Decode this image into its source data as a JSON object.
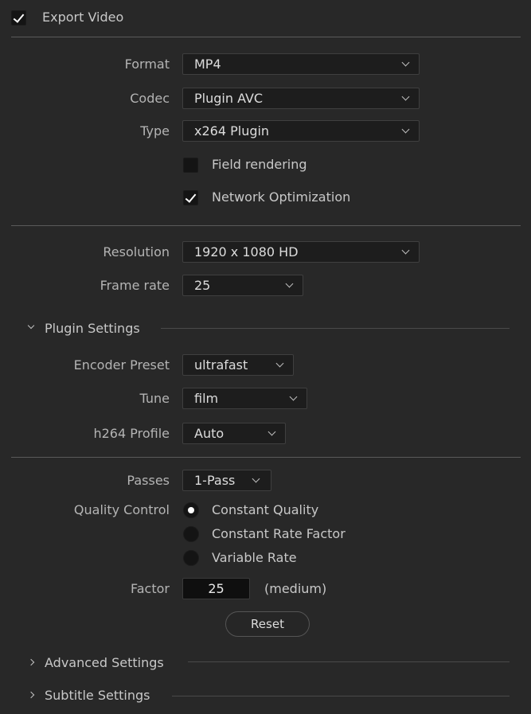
{
  "export_video": {
    "label": "Export Video",
    "checked": true
  },
  "video": {
    "format": {
      "label": "Format",
      "value": "MP4"
    },
    "codec": {
      "label": "Codec",
      "value": "Plugin AVC"
    },
    "type": {
      "label": "Type",
      "value": "x264 Plugin"
    },
    "field_rendering": {
      "label": "Field rendering",
      "checked": false
    },
    "network_optimization": {
      "label": "Network Optimization",
      "checked": true
    }
  },
  "resolution": {
    "label": "Resolution",
    "value": "1920 x 1080 HD"
  },
  "frame_rate": {
    "label": "Frame rate",
    "value": "25"
  },
  "plugin_settings": {
    "title": "Plugin Settings",
    "encoder_preset": {
      "label": "Encoder Preset",
      "value": "ultrafast"
    },
    "tune": {
      "label": "Tune",
      "value": "film"
    },
    "h264_profile": {
      "label": "h264 Profile",
      "value": "Auto"
    }
  },
  "passes": {
    "label": "Passes",
    "value": "1-Pass"
  },
  "quality_control": {
    "label": "Quality Control",
    "options": [
      "Constant Quality",
      "Constant Rate Factor",
      "Variable Rate"
    ],
    "selected": "Constant Quality"
  },
  "factor": {
    "label": "Factor",
    "value": "25",
    "hint": "(medium)"
  },
  "reset_label": "Reset",
  "advanced_settings": {
    "title": "Advanced Settings"
  },
  "subtitle_settings": {
    "title": "Subtitle Settings"
  },
  "colors": {
    "background": "#282828",
    "field": "#1d1d1d",
    "text": "#c8c8c8"
  }
}
